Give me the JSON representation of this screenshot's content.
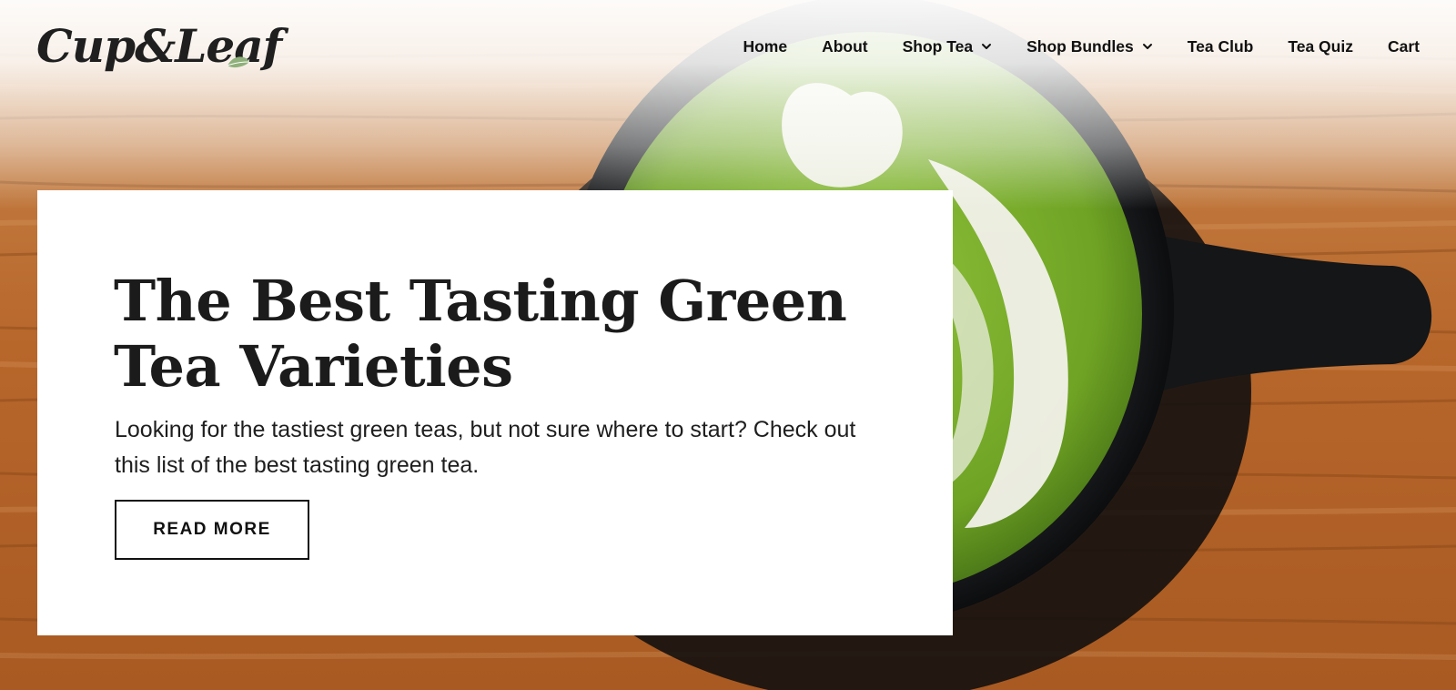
{
  "brand": {
    "name": "Cup&Leaf"
  },
  "nav": {
    "items": [
      {
        "label": "Home",
        "dropdown": false
      },
      {
        "label": "About",
        "dropdown": false
      },
      {
        "label": "Shop Tea",
        "dropdown": true
      },
      {
        "label": "Shop Bundles",
        "dropdown": true
      },
      {
        "label": "Tea Club",
        "dropdown": false
      },
      {
        "label": "Tea Quiz",
        "dropdown": false
      },
      {
        "label": "Cart",
        "dropdown": false
      }
    ]
  },
  "hero": {
    "title": "The Best Tasting Green Tea Varieties",
    "subtitle": "Looking for the tastiest green teas, but not sure where to start? Check out this list of the best tasting green tea.",
    "cta_label": "READ MORE",
    "image_subject": "matcha latte in black cup on wooden table"
  },
  "colors": {
    "text": "#1b1b1b",
    "leaf_accent": "#8fb07a",
    "wood": "#b56b2f",
    "matcha": "#7aaa2a",
    "cup": "#121417"
  }
}
